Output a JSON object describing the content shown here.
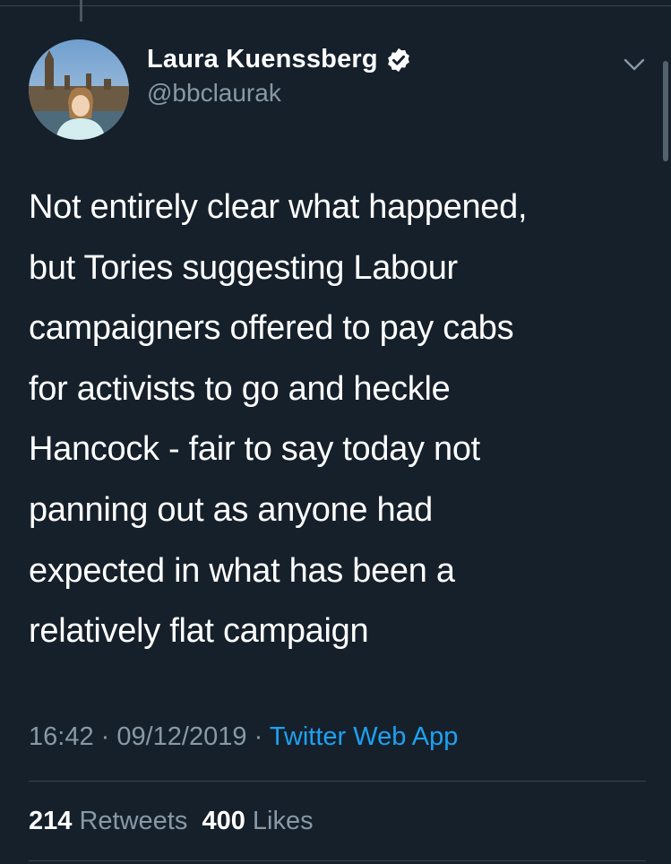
{
  "author": {
    "display_name": "Laura Kuenssberg",
    "handle": "@bbclaurak",
    "verified": true
  },
  "tweet": {
    "lines": [
      "Not entirely clear what happened,",
      "but Tories suggesting Labour",
      "campaigners offered to pay cabs",
      "for activists to go and heckle",
      "Hancock - fair to say today not",
      "panning out as anyone had",
      "expected in what has been a",
      "relatively flat campaign"
    ]
  },
  "meta": {
    "time": "16:42",
    "sep1": " · ",
    "date": "09/12/2019",
    "sep2": " · ",
    "source": "Twitter Web App"
  },
  "stats": {
    "retweets_count": "214",
    "retweets_label": "Retweets",
    "likes_count": "400",
    "likes_label": "Likes"
  },
  "icons": {
    "verified": "verified-badge-icon",
    "chevron": "chevron-down-icon"
  },
  "colors": {
    "background": "#15202b",
    "text": "#ffffff",
    "secondary": "#8899a6",
    "link": "#1da1f2",
    "divider": "#38444d"
  }
}
